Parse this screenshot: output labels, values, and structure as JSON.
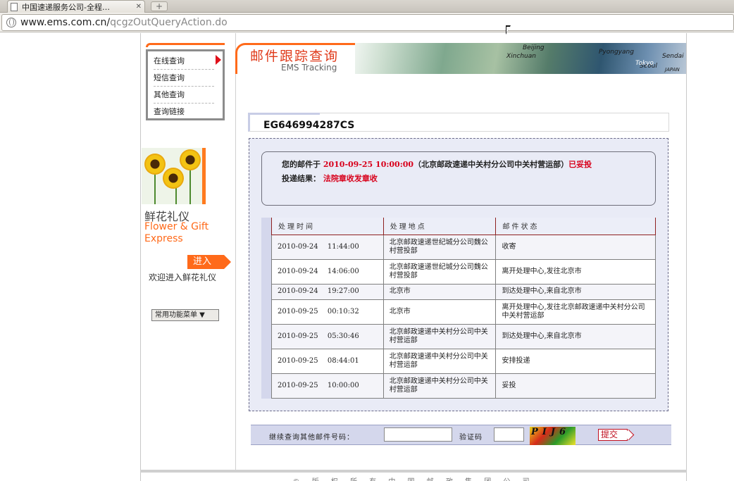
{
  "browser": {
    "tab_title": "中国速递服务公司-全程…",
    "tab_close": "✕",
    "newtab": "+",
    "url_host": "www.ems.com.cn/",
    "url_path": "qcgzOutQueryAction.do"
  },
  "sidebar": {
    "items": [
      {
        "label": "在线查询"
      },
      {
        "label": "短信查询"
      },
      {
        "label": "其他查询"
      },
      {
        "label": "查询链接"
      }
    ],
    "ad": {
      "title_cn": "鲜花礼仪",
      "title_en1": "Flower & Gift",
      "title_en2": "Express",
      "enter_label": "进入",
      "welcome": "欢迎进入鲜花礼仪"
    },
    "common_menu_label": "常用功能菜单 ▼"
  },
  "header": {
    "title_cn": "邮件跟踪查询",
    "title_en": "EMS Tracking",
    "map_labels": [
      "Beijing",
      "Pyongyang",
      "Seoul",
      "Sendai",
      "Tokyo",
      "Xinchuan",
      "JAPAN"
    ]
  },
  "tracking": {
    "number": "EG646994287CS",
    "summary_prefix": "您的邮件于",
    "summary_time": "2010-09-25 10:00:00",
    "summary_place": "（北京邮政速递中关村分公司中关村营运部）",
    "summary_status": "已妥投",
    "result_label": "投递结果：",
    "result_value": "法院章收发章收",
    "columns": [
      "处理时间",
      "处理地点",
      "邮件状态"
    ],
    "rows": [
      {
        "time": "2010-09-24　 11:44:00",
        "place": "北京邮政速递世纪城分公司魏公村营投部",
        "status": "收寄"
      },
      {
        "time": "2010-09-24　 14:06:00",
        "place": "北京邮政速递世纪城分公司魏公村营投部",
        "status": "离开处理中心,发往北京市"
      },
      {
        "time": "2010-09-24　 19:27:00",
        "place": "北京市",
        "status": "到达处理中心,来自北京市"
      },
      {
        "time": "2010-09-25　 00:10:32",
        "place": "北京市",
        "status": "离开处理中心,发往北京邮政速递中关村分公司中关村营运部"
      },
      {
        "time": "2010-09-25　 05:30:46",
        "place": "北京邮政速递中关村分公司中关村营运部",
        "status": "到达处理中心,来自北京市"
      },
      {
        "time": "2010-09-25　 08:44:01",
        "place": "北京邮政速递中关村分公司中关村营运部",
        "status": "安排投递"
      },
      {
        "time": "2010-09-25　 10:00:00",
        "place": "北京邮政速递中关村分公司中关村营运部",
        "status": "妥投"
      }
    ]
  },
  "query": {
    "label": "继续查询其他邮件号码：",
    "input_value": "",
    "verify_label": "验证码",
    "verify_value": "",
    "captcha_text": "PIJ6",
    "submit_label": "提交"
  },
  "footer": {
    "text": "© 版 权 所 有 中 国 邮 政 集 团 公 司"
  },
  "colors": {
    "accent": "#ff6a1a",
    "status_red": "#d8001b",
    "panel_bg": "#e9ebf6"
  }
}
